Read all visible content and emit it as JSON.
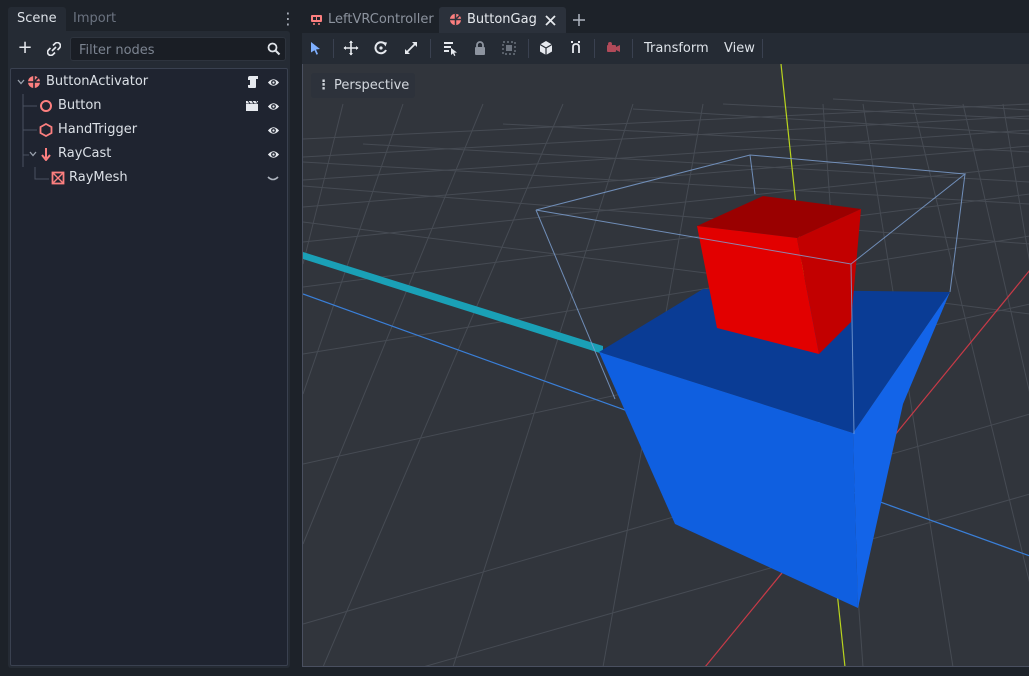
{
  "dock": {
    "tabs": [
      {
        "label": "Scene",
        "active": true
      },
      {
        "label": "Import",
        "active": false
      }
    ],
    "menu_icon": "kebab-menu-icon",
    "add_icon": "plus-icon",
    "link_icon": "link-icon",
    "filter": {
      "placeholder": "Filter nodes",
      "value": ""
    },
    "search_icon": "search-icon",
    "tree": [
      {
        "label": "ButtonActivator",
        "icon": "spatial-node-icon",
        "expanded": true,
        "badge": "script-icon",
        "visible": true
      },
      {
        "label": "Button",
        "icon": "area-node-icon",
        "badge": "clapperboard-icon",
        "visible": true
      },
      {
        "label": "HandTrigger",
        "icon": "collision-shape-icon",
        "visible": true
      },
      {
        "label": "RayCast",
        "icon": "raycast-icon",
        "expanded": true,
        "visible": true
      },
      {
        "label": "RayMesh",
        "icon": "mesh-instance-icon",
        "visible": "hidden-chevron"
      }
    ]
  },
  "editor": {
    "tabs": [
      {
        "label": "LeftVRController",
        "active": false
      },
      {
        "label": "ButtonGag",
        "active": true
      }
    ],
    "close_icon": "close-icon",
    "new_tab_icon": "plus-icon",
    "toolbar": {
      "icons": [
        "select-tool-icon",
        "move-tool-icon",
        "rotate-tool-icon",
        "scale-tool-icon",
        "list-select-icon",
        "lock-icon",
        "group-icon",
        "local-space-icon",
        "snap-icon",
        "camera-icon"
      ],
      "transform_menu": "Transform",
      "view_menu": "View"
    },
    "viewport": {
      "perspective_label": "Perspective",
      "colors": {
        "red_cube": "#e00000",
        "blue_box": "#0a55d8",
        "ray": "#1aa0b6",
        "x_axis": "#c63a47",
        "y_axis": "#b9d41e",
        "z_axis": "#3a7fd8"
      }
    }
  }
}
